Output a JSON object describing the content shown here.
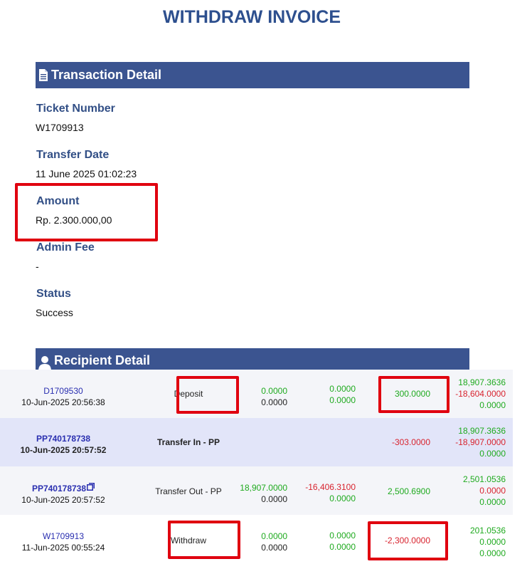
{
  "page_title": "WITHDRAW INVOICE",
  "transaction_section": {
    "title": "Transaction Detail",
    "icon": "document-icon",
    "fields": [
      {
        "label": "Ticket Number",
        "value": "W1709913"
      },
      {
        "label": "Transfer Date",
        "value": "11 June 2025 01:02:23"
      },
      {
        "label": "Amount",
        "value": "Rp. 2.300.000,00"
      },
      {
        "label": "Admin Fee",
        "value": "-"
      },
      {
        "label": "Status",
        "value": "Success"
      }
    ]
  },
  "recipient_section": {
    "title": "Recipient Detail",
    "icon": "user-icon"
  },
  "colors": {
    "accent": "#3b5490",
    "title": "#2d4f8e",
    "label": "#324f86",
    "positive": "#1faa1f",
    "negative": "#d8232e",
    "link": "#2a2fb0",
    "highlight": "#e0000f"
  },
  "transactions": [
    {
      "id": "D1709530",
      "datetime": "10-Jun-2025 20:56:38",
      "type": "Deposit",
      "col_a": [
        "0.0000",
        "0.0000"
      ],
      "col_b": [
        "0.0000",
        "0.0000"
      ],
      "amount": "300.0000",
      "balance": [
        "18,907.3636",
        "-18,604.0000",
        "0.0000"
      ]
    },
    {
      "id": "PP740178738",
      "datetime": "10-Jun-2025 20:57:52",
      "type": "Transfer In - PP",
      "amount": "-303.0000",
      "balance": [
        "18,907.3636",
        "-18,907.0000",
        "0.0000"
      ]
    },
    {
      "id": "PP740178738",
      "datetime": "10-Jun-2025 20:57:52",
      "type": "Transfer Out - PP",
      "col_a": [
        "18,907.0000",
        "0.0000"
      ],
      "col_b": [
        "-16,406.3100",
        "0.0000"
      ],
      "amount": "2,500.6900",
      "balance": [
        "2,501.0536",
        "0.0000",
        "0.0000"
      ]
    },
    {
      "id": "W1709913",
      "datetime": "11-Jun-2025 00:55:24",
      "type": "Withdraw",
      "col_a": [
        "0.0000",
        "0.0000"
      ],
      "col_b": [
        "0.0000",
        "0.0000"
      ],
      "amount": "-2,300.0000",
      "balance": [
        "201.0536",
        "0.0000",
        "0.0000"
      ]
    }
  ]
}
